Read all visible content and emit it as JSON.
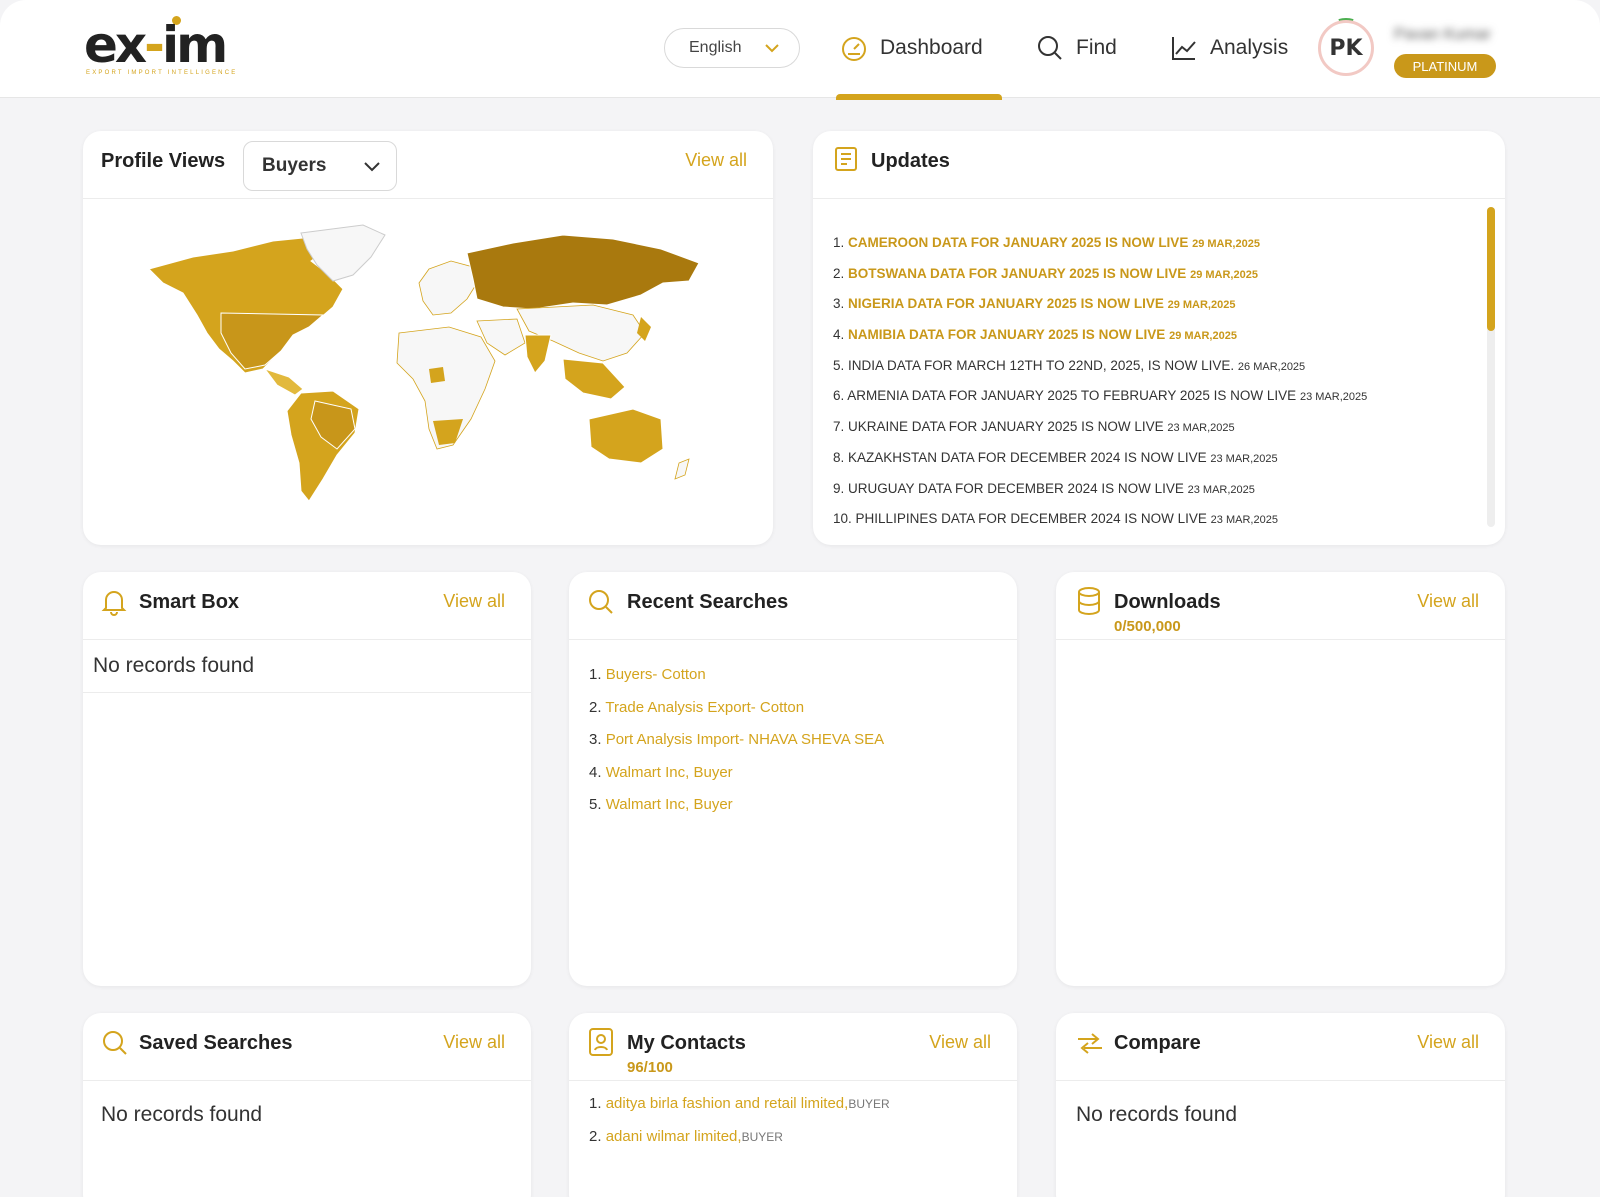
{
  "brand": {
    "logo_text_left": "ex",
    "logo_text_dash": "-",
    "logo_text_right": "im",
    "tagline": "EXPORT IMPORT INTELLIGENCE"
  },
  "header": {
    "language": "English",
    "nav": {
      "dashboard": "Dashboard",
      "find": "Find",
      "analysis": "Analysis"
    },
    "user": {
      "initials": "PK",
      "name": "Pavan Kumar",
      "plan": "PLATINUM"
    }
  },
  "profile_views": {
    "title": "Profile Views",
    "filter_value": "Buyers",
    "view_all": "View all"
  },
  "updates": {
    "title": "Updates",
    "items": [
      {
        "num": "1.",
        "text": "CAMEROON DATA FOR JANUARY 2025 IS NOW LIVE",
        "date": "29 MAR,2025"
      },
      {
        "num": "2.",
        "text": "BOTSWANA DATA FOR JANUARY 2025 IS NOW LIVE",
        "date": "29 MAR,2025"
      },
      {
        "num": "3.",
        "text": "NIGERIA DATA FOR JANUARY 2025 IS NOW LIVE",
        "date": "29 MAR,2025"
      },
      {
        "num": "4.",
        "text": "NAMIBIA DATA FOR JANUARY 2025 IS NOW LIVE",
        "date": "29 MAR,2025"
      },
      {
        "num": "5.",
        "text": "INDIA DATA FOR MARCH 12TH TO 22ND, 2025, IS NOW LIVE.",
        "date": "26 MAR,2025"
      },
      {
        "num": "6.",
        "text": "ARMENIA DATA FOR JANUARY 2025 TO FEBRUARY 2025 IS NOW LIVE",
        "date": "23 MAR,2025"
      },
      {
        "num": "7.",
        "text": "UKRAINE DATA FOR JANUARY 2025 IS NOW LIVE",
        "date": "23 MAR,2025"
      },
      {
        "num": "8.",
        "text": "KAZAKHSTAN DATA FOR DECEMBER 2024 IS NOW LIVE",
        "date": "23 MAR,2025"
      },
      {
        "num": "9.",
        "text": "URUGUAY DATA FOR DECEMBER 2024 IS NOW LIVE",
        "date": "23 MAR,2025"
      },
      {
        "num": "10.",
        "text": "PHILLIPINES DATA FOR DECEMBER 2024 IS NOW LIVE",
        "date": "23 MAR,2025"
      }
    ]
  },
  "smart_box": {
    "title": "Smart Box",
    "view_all": "View all",
    "empty": "No records found"
  },
  "recent_searches": {
    "title": "Recent Searches",
    "items": [
      {
        "num": "1.",
        "text": "Buyers- Cotton"
      },
      {
        "num": "2.",
        "text": "Trade Analysis Export- Cotton"
      },
      {
        "num": "3.",
        "text": "Port Analysis Import- NHAVA SHEVA SEA"
      },
      {
        "num": "4.",
        "text": "Walmart Inc, Buyer"
      },
      {
        "num": "5.",
        "text": "Walmart Inc, Buyer"
      }
    ]
  },
  "downloads": {
    "title": "Downloads",
    "count": "0/500,000",
    "view_all": "View all"
  },
  "saved_searches": {
    "title": "Saved Searches",
    "view_all": "View all",
    "empty": "No records found"
  },
  "my_contacts": {
    "title": "My Contacts",
    "count": "96/100",
    "view_all": "View all",
    "items": [
      {
        "num": "1.",
        "name": "aditya birla fashion and retail limited,",
        "role": "BUYER"
      },
      {
        "num": "2.",
        "name": "adani wilmar limited,",
        "role": "BUYER"
      }
    ]
  },
  "compare": {
    "title": "Compare",
    "view_all": "View all",
    "empty": "No records found"
  },
  "colors": {
    "accent": "#d4a41d",
    "accent_dark": "#a9790e",
    "map_empty": "#f7f7f7"
  }
}
